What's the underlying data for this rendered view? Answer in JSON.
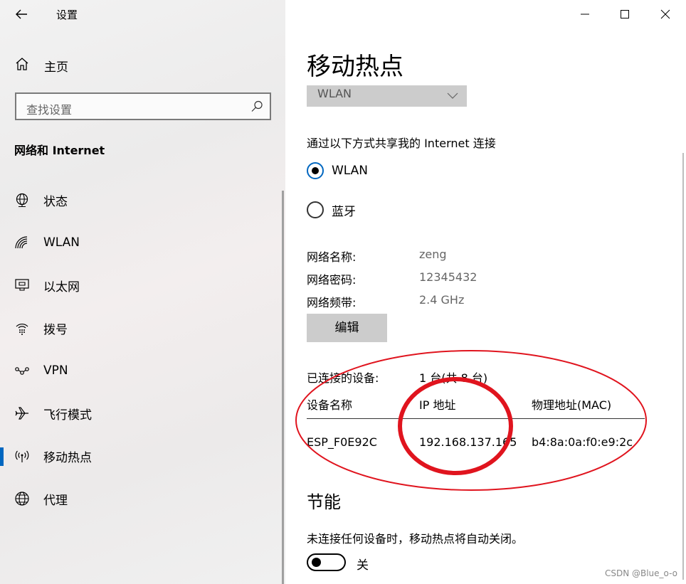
{
  "window": {
    "title": "设置"
  },
  "sidebar": {
    "home": "主页",
    "search_placeholder": "查找设置",
    "section_title": "网络和 Internet",
    "items": [
      {
        "label": "状态",
        "icon": "globe-status-icon"
      },
      {
        "label": "WLAN",
        "icon": "wifi-icon"
      },
      {
        "label": "以太网",
        "icon": "ethernet-icon"
      },
      {
        "label": "拨号",
        "icon": "dialup-icon"
      },
      {
        "label": "VPN",
        "icon": "vpn-icon"
      },
      {
        "label": "飞行模式",
        "icon": "airplane-icon"
      },
      {
        "label": "移动热点",
        "icon": "hotspot-icon",
        "active": true
      },
      {
        "label": "代理",
        "icon": "globe-icon"
      }
    ]
  },
  "main": {
    "title": "移动热点",
    "share_from_value": "WLAN",
    "share_via_label": "通过以下方式共享我的 Internet 连接",
    "share_via_options": [
      {
        "label": "WLAN",
        "checked": true
      },
      {
        "label": "蓝牙",
        "checked": false
      }
    ],
    "network": [
      {
        "key": "网络名称:",
        "value": "zeng"
      },
      {
        "key": "网络密码:",
        "value": "12345432"
      },
      {
        "key": "网络频带:",
        "value": "2.4 GHz"
      }
    ],
    "edit_button": "编辑",
    "connected_label": "已连接的设备:",
    "connected_value": "1 台(共 8 台)",
    "table": {
      "headers": [
        "设备名称",
        "IP 地址",
        "物理地址(MAC)"
      ],
      "rows": [
        [
          "ESP_F0E92C",
          "192.168.137.165",
          "b4:8a:0a:f0:e9:2c"
        ]
      ]
    },
    "power_saving": {
      "title": "节能",
      "description": "未连接任何设备时，移动热点将自动关闭。",
      "toggle_label": "关",
      "toggle_on": false
    }
  },
  "watermark": "CSDN @Blue_o-o",
  "colors": {
    "accent": "#0067c0",
    "annotation": "#e0141e",
    "sidebar_bg": "#f0f0f0",
    "button_bg": "#cccccc"
  }
}
